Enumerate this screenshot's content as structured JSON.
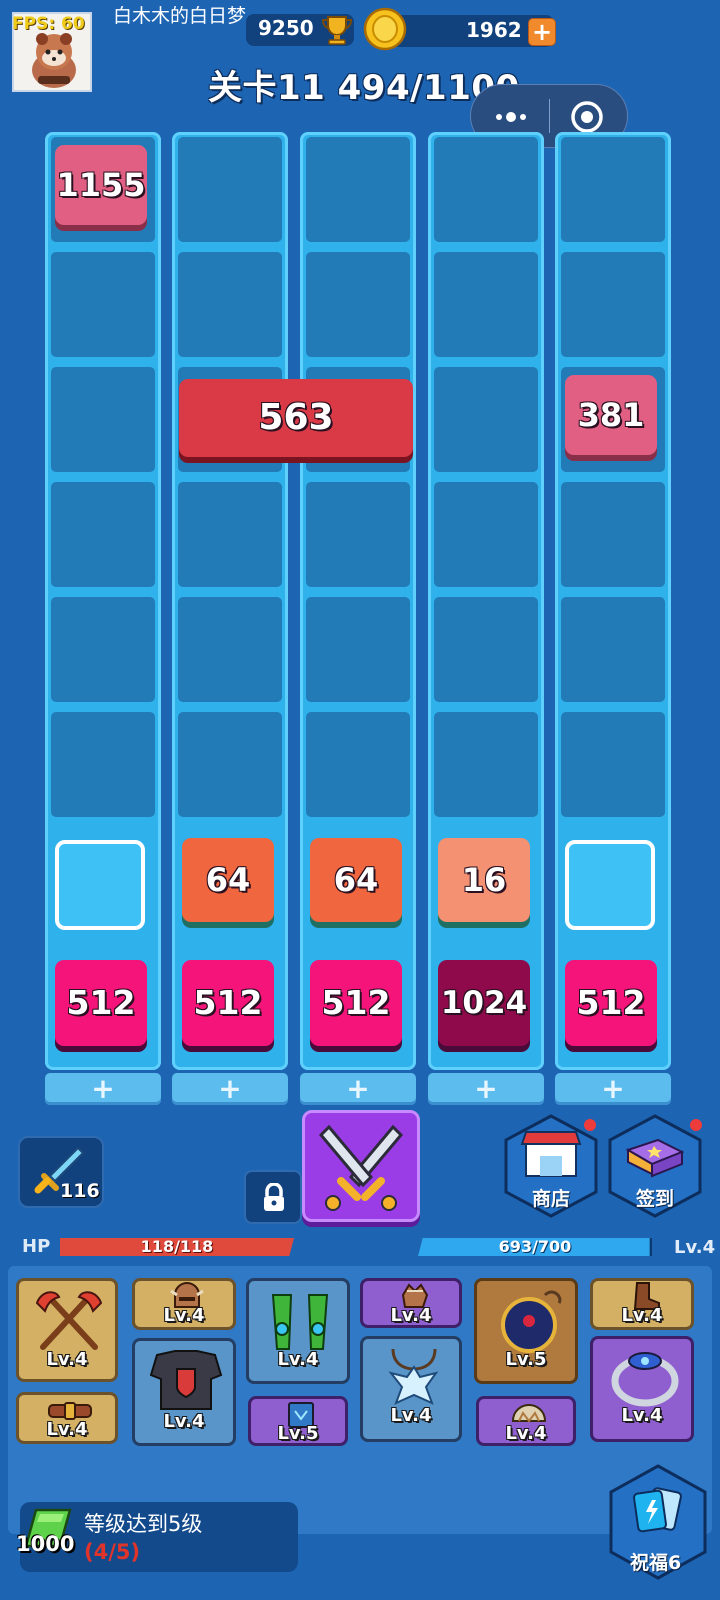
{
  "header": {
    "fps_text": "FPS: 60",
    "username": "白木木的白日梦",
    "trophies": "9250",
    "coins": "1962",
    "plus_symbol": "+",
    "level_title": "关卡11 494/1100"
  },
  "board": {
    "columns": [
      {
        "top_tile": "1155",
        "top_tile_color": "#e05f82",
        "mid_tile": "",
        "slot": "",
        "bottom_tile": "512",
        "bottom_color": "#f5157a"
      },
      {
        "top_tile": "",
        "top_tile_color": "",
        "mid_tile": "563",
        "slot": "64",
        "bottom_tile": "512",
        "bottom_color": "#f5157a"
      },
      {
        "top_tile": "",
        "top_tile_color": "",
        "mid_tile": "",
        "slot": "64",
        "bottom_tile": "512",
        "bottom_color": "#f5157a"
      },
      {
        "top_tile": "",
        "top_tile_color": "",
        "mid_tile": "",
        "slot": "16",
        "bottom_tile": "1024",
        "bottom_color": "#8e0a4a"
      },
      {
        "top_tile": "381",
        "top_tile_color": "#e05f82",
        "mid_tile": "",
        "slot": "",
        "bottom_tile": "512",
        "bottom_color": "#f5157a"
      }
    ],
    "wide_tile": {
      "value": "563",
      "color": "#d93a45"
    },
    "slot_colors": {
      "64": "#f0663e",
      "16": "#f49172"
    },
    "add_label": "+"
  },
  "actions": {
    "sword_count": "116",
    "shop_label": "商店",
    "signin_label": "签到"
  },
  "stats": {
    "hp_label": "HP",
    "hp_text": "118/118",
    "hp_fraction": 1.0,
    "xp_text": "693/700",
    "xp_fraction": 0.99,
    "level_text": "Lv.4"
  },
  "equipment": [
    {
      "name": "axes",
      "lv": "Lv.4"
    },
    {
      "name": "belt",
      "lv": "Lv.4"
    },
    {
      "name": "helmet",
      "lv": "Lv.4"
    },
    {
      "name": "armor",
      "lv": "Lv.4"
    },
    {
      "name": "bracers",
      "lv": "Lv.4"
    },
    {
      "name": "spellbook",
      "lv": "Lv.5"
    },
    {
      "name": "glove",
      "lv": "Lv.4"
    },
    {
      "name": "amulet",
      "lv": "Lv.4"
    },
    {
      "name": "bomb",
      "lv": "Lv.5"
    },
    {
      "name": "shoulder",
      "lv": "Lv.4"
    },
    {
      "name": "boots",
      "lv": "Lv.4"
    },
    {
      "name": "ring",
      "lv": "Lv.4"
    }
  ],
  "quest": {
    "title": "等级达到5级",
    "progress": "(4/5)",
    "gem_count": "1000"
  },
  "blessing": {
    "label": "祝福6"
  }
}
